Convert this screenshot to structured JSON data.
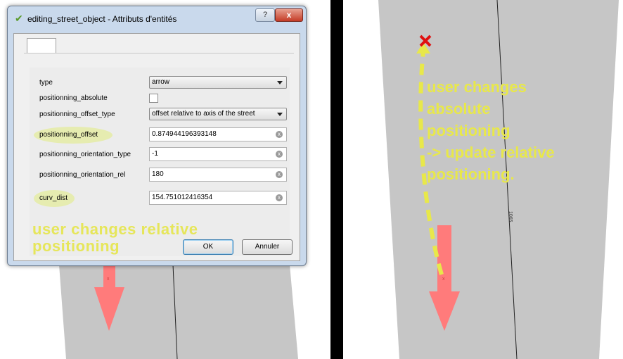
{
  "dialog": {
    "title": "editing_street_object - Attributs d'entités",
    "help_label": "?",
    "close_label": "x",
    "fields": {
      "type": {
        "label": "type",
        "value": "arrow"
      },
      "positionning_absolute": {
        "label": "positionning_absolute",
        "checked": false
      },
      "positionning_offset_type": {
        "label": "positionning_offset_type",
        "value": "offset relative to axis of the street"
      },
      "positionning_offset": {
        "label": "positionning_offset",
        "value": "0.874944196393148"
      },
      "positionning_orientation_type": {
        "label": "positionning_orientation_type",
        "value": "-1"
      },
      "positionning_orientation_rel": {
        "label": "positionning_orientation_rel",
        "value": "180"
      },
      "curv_dist": {
        "label": "curv_dist",
        "value": "154.751012416354"
      }
    },
    "ok_label": "OK",
    "cancel_label": "Annuler"
  },
  "annotations": {
    "left": {
      "line1": "user changes relative",
      "line2": "positioning"
    },
    "right": {
      "line1": "user changes",
      "line2": "absolute",
      "line3": "positioning",
      "line4": "-> update relative",
      "line5": "positioning."
    }
  },
  "map": {
    "street_label": "1065",
    "colors": {
      "street": "#c6c6c6",
      "arrow": "#ff7b7b",
      "annotation": "#e8e84a",
      "highlight": "#e6ecb0",
      "target_marker": "#e01010"
    },
    "icons": [
      "checked-icon",
      "clear-field-icon",
      "dropdown-arrow-icon",
      "close-icon",
      "help-icon",
      "arrow-symbol",
      "target-x-icon"
    ]
  }
}
